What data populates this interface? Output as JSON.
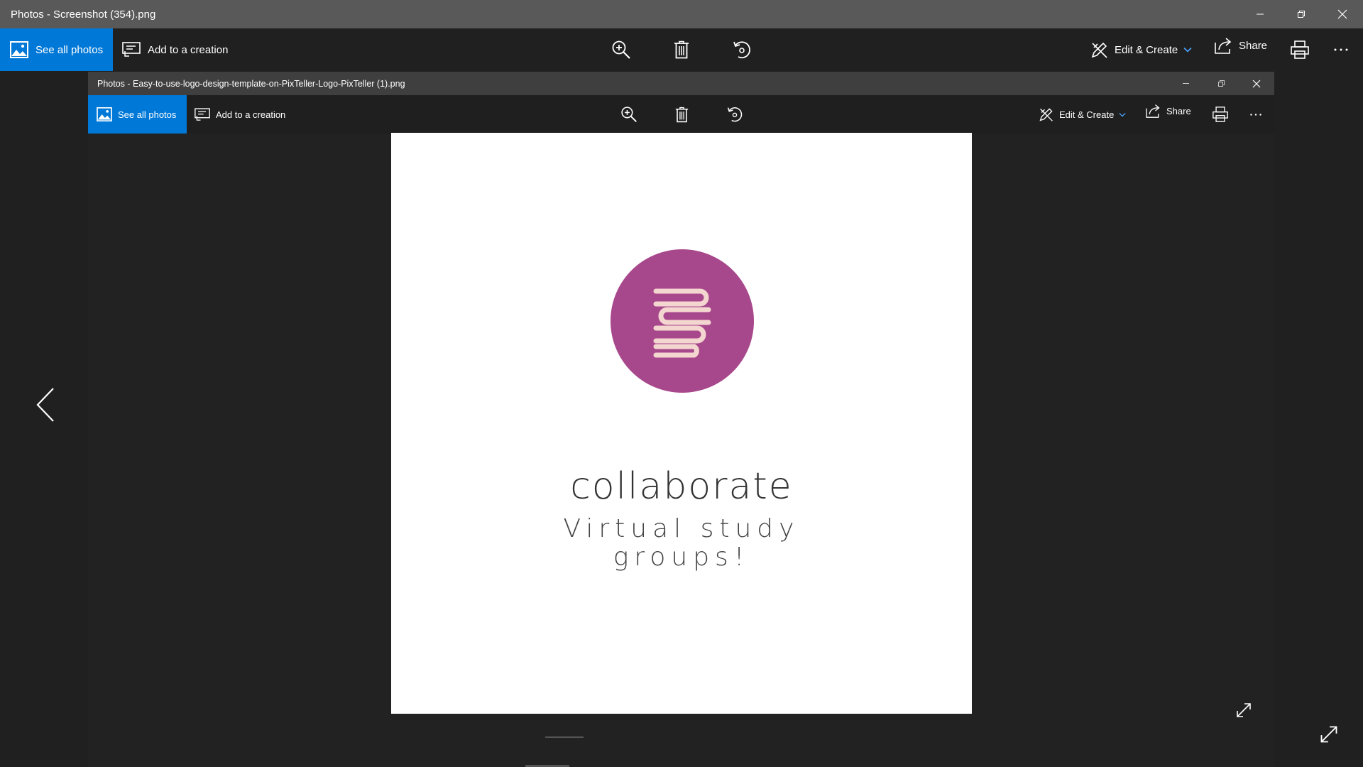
{
  "outer_window": {
    "title": "Photos - Screenshot (354).png",
    "toolbar": {
      "see_all_photos": "See all photos",
      "add_to_creation": "Add to a creation",
      "edit_create": "Edit & Create",
      "share": "Share"
    }
  },
  "inner_window": {
    "title": "Photos - Easy-to-use-logo-design-template-on-PixTeller-Logo-PixTeller (1).png",
    "toolbar": {
      "see_all_photos": "See all photos",
      "add_to_creation": "Add to a creation",
      "edit_create": "Edit & Create",
      "share": "Share"
    }
  },
  "photo": {
    "logo_title": "collaborate",
    "logo_subtitle_line1": "Virtual study",
    "logo_subtitle_line2": "groups!",
    "circle_color": "#a8488c",
    "icon_color": "#f3d6cf"
  },
  "colors": {
    "accent": "#0078d7",
    "titlebar": "#595959",
    "background": "#202020"
  },
  "icons": [
    "image-icon",
    "creation-icon",
    "zoom-in-icon",
    "delete-icon",
    "rotate-icon",
    "edit-create-icon",
    "chevron-down-icon",
    "share-icon",
    "print-icon",
    "more-icon",
    "minimize-icon",
    "restore-icon",
    "close-icon",
    "chevron-left-icon",
    "expand-icon",
    "books-icon"
  ]
}
